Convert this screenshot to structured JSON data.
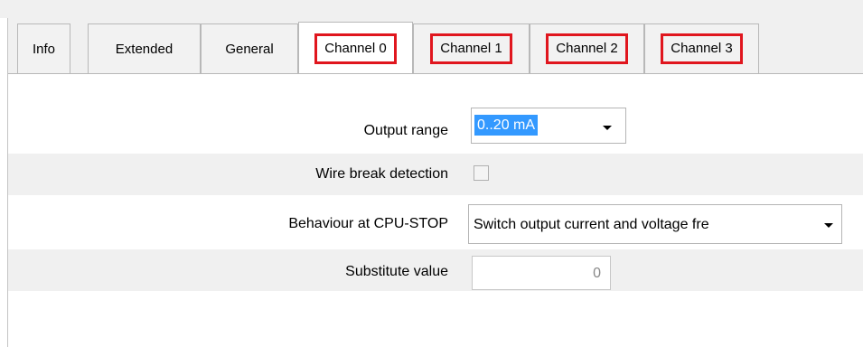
{
  "tabs": [
    {
      "label": "Info",
      "active": false,
      "highlighted": false
    },
    {
      "label": "Extended",
      "active": false,
      "highlighted": false
    },
    {
      "label": "General",
      "active": false,
      "highlighted": false
    },
    {
      "label": "Channel 0",
      "active": true,
      "highlighted": true
    },
    {
      "label": "Channel 1",
      "active": false,
      "highlighted": true
    },
    {
      "label": "Channel 2",
      "active": false,
      "highlighted": true
    },
    {
      "label": "Channel 3",
      "active": false,
      "highlighted": true
    }
  ],
  "form": {
    "output_range": {
      "label": "Output range",
      "value": "0..20 mA"
    },
    "wire_break": {
      "label": "Wire break detection",
      "checked": false
    },
    "behaviour": {
      "label": "Behaviour at CPU-STOP",
      "value": "Switch output current and voltage fre"
    },
    "substitute": {
      "label": "Substitute value",
      "value": "0"
    }
  },
  "colors": {
    "highlight": "#e0161e",
    "selection": "#3399ff",
    "shade": "#f0f0f0"
  },
  "icons": {
    "dropdown": "chevron-down-icon"
  }
}
